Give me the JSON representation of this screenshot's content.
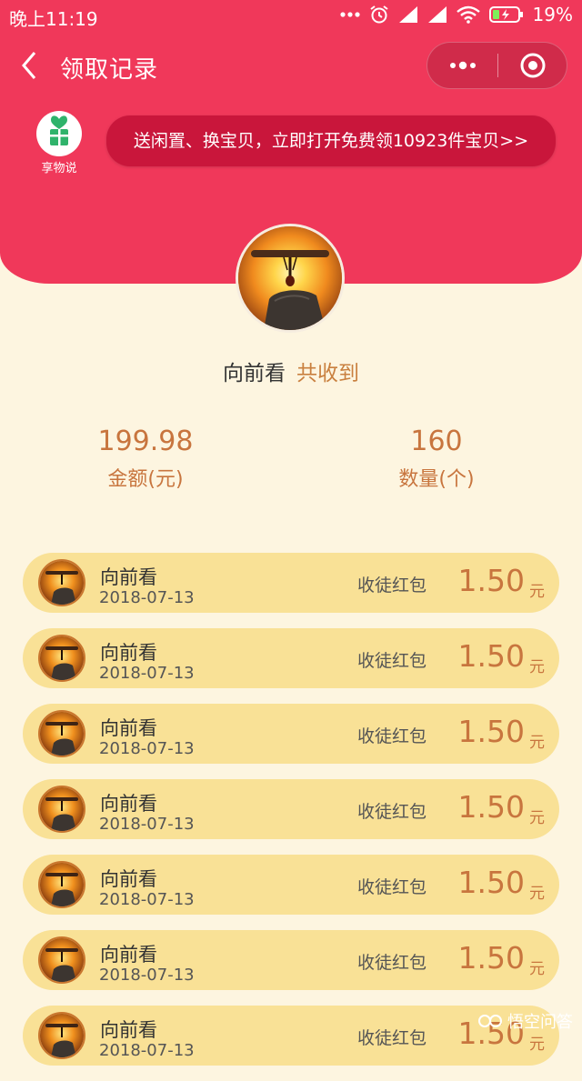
{
  "status_bar": {
    "time": "晚上11:19",
    "battery": "19%",
    "icons": [
      "dots-icon",
      "alarm-icon",
      "signal-icon",
      "signal-icon",
      "wifi-icon",
      "battery-icon"
    ]
  },
  "navbar": {
    "title": "领取记录",
    "icons": [
      "back-icon",
      "more-icon",
      "target-icon"
    ]
  },
  "app": {
    "name": "享物说"
  },
  "promo": {
    "text": "送闲置、换宝贝，立即打开免费领10923件宝贝>>"
  },
  "summary": {
    "name": "向前看",
    "suffix": "共收到"
  },
  "stats": [
    {
      "value": "199.98",
      "label": "金额(元)"
    },
    {
      "value": "160",
      "label": "数量(个)"
    }
  ],
  "records": [
    {
      "name": "向前看",
      "date": "2018-07-13",
      "type": "收徒红包",
      "amount": "1.50",
      "unit": "元"
    },
    {
      "name": "向前看",
      "date": "2018-07-13",
      "type": "收徒红包",
      "amount": "1.50",
      "unit": "元"
    },
    {
      "name": "向前看",
      "date": "2018-07-13",
      "type": "收徒红包",
      "amount": "1.50",
      "unit": "元"
    },
    {
      "name": "向前看",
      "date": "2018-07-13",
      "type": "收徒红包",
      "amount": "1.50",
      "unit": "元"
    },
    {
      "name": "向前看",
      "date": "2018-07-13",
      "type": "收徒红包",
      "amount": "1.50",
      "unit": "元"
    },
    {
      "name": "向前看",
      "date": "2018-07-13",
      "type": "收徒红包",
      "amount": "1.50",
      "unit": "元"
    },
    {
      "name": "向前看",
      "date": "2018-07-13",
      "type": "收徒红包",
      "amount": "1.50",
      "unit": "元"
    }
  ],
  "watermark": {
    "text": "悟空问答"
  },
  "colors": {
    "header": "#f0385a",
    "banner": "#c9163b",
    "page_bg": "#fdf5e0",
    "row_bg": "#f9e196",
    "amount": "#c8753e"
  }
}
